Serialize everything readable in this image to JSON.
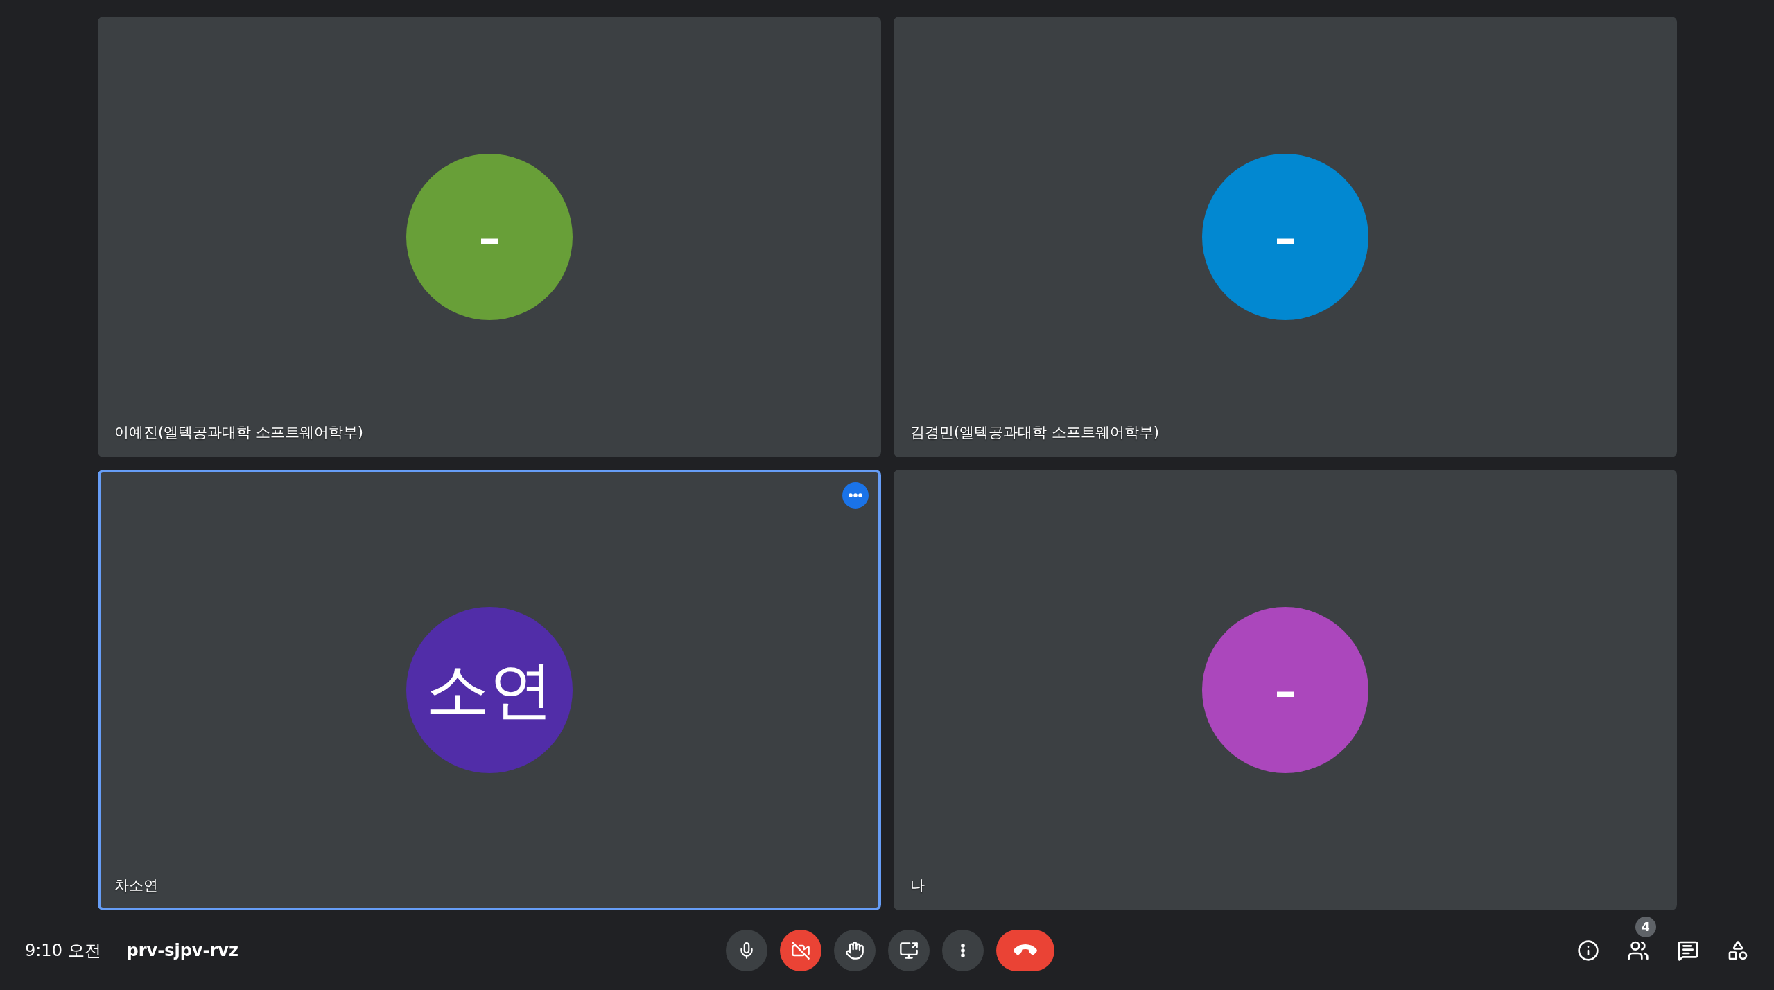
{
  "tiles": [
    {
      "name": "이예진(엘텍공과대학 소프트웨어학부)",
      "initials": "-",
      "color": "#689f38",
      "selected": false
    },
    {
      "name": "김경민(엘텍공과대학 소프트웨어학부)",
      "initials": "-",
      "color": "#0288d1",
      "selected": false
    },
    {
      "name": "차소연",
      "initials": "소연",
      "color": "#512da8",
      "selected": true
    },
    {
      "name": "나",
      "initials": "-",
      "color": "#ab47bc",
      "selected": false
    }
  ],
  "meeting": {
    "time": "9:10 오전",
    "code": "prv-sjpv-rvz"
  },
  "controls": [
    {
      "kind": "mic",
      "off": false
    },
    {
      "kind": "camera",
      "off": true
    },
    {
      "kind": "hand"
    },
    {
      "kind": "present"
    },
    {
      "kind": "more"
    },
    {
      "kind": "leave"
    }
  ],
  "side_buttons": [
    {
      "kind": "info"
    },
    {
      "kind": "people",
      "badge": "4"
    },
    {
      "kind": "chat"
    },
    {
      "kind": "activities"
    }
  ]
}
